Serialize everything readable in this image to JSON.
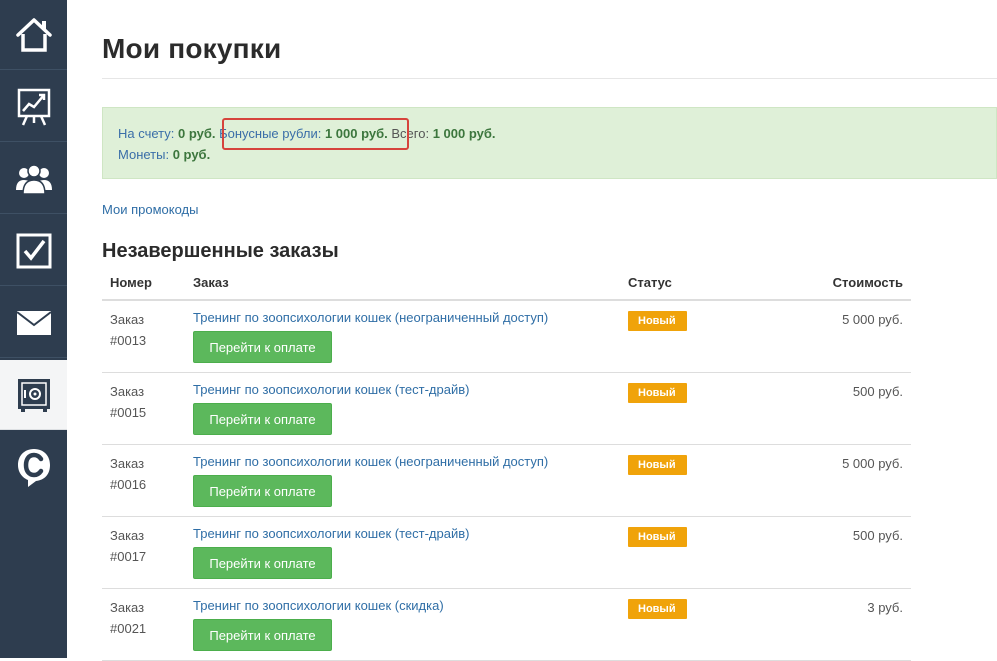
{
  "page": {
    "title": "Мои покупки"
  },
  "colors": {
    "sidebar_bg": "#2e3d4f",
    "balance_bg": "#dff0d8",
    "pay_button": "#5cb85c",
    "status_new": "#f0a30a",
    "highlight_border": "#d6443c",
    "link": "#2f6ea6"
  },
  "sidebar": {
    "items": [
      {
        "name": "home",
        "icon": "home-icon"
      },
      {
        "name": "stats",
        "icon": "chart-board-icon"
      },
      {
        "name": "users",
        "icon": "users-icon"
      },
      {
        "name": "tasks",
        "icon": "checkbox-icon"
      },
      {
        "name": "messages",
        "icon": "envelope-icon"
      },
      {
        "name": "purchases",
        "icon": "safe-icon",
        "active": true
      },
      {
        "name": "chat",
        "icon": "chat-c-icon"
      }
    ]
  },
  "balance": {
    "account_label": "На счету:",
    "account_value": "0 руб.",
    "bonus_label": "Бонусные рубли:",
    "bonus_value": "1 000 руб.",
    "total_label": "Всего:",
    "total_value": "1 000 руб.",
    "coins_label": "Монеты:",
    "coins_value": "0 руб."
  },
  "promo_link": "Мои промокоды",
  "orders_section": {
    "title": "Незавершенные заказы",
    "headers": {
      "number": "Номер",
      "order": "Заказ",
      "status": "Статус",
      "cost": "Стоимость"
    },
    "pay_label": "Перейти к оплате",
    "rows": [
      {
        "num_label": "Заказ",
        "num": "#0013",
        "title": "Тренинг по зоопсихологии кошек (неограниченный доступ)",
        "status": "Новый",
        "cost": "5 000 руб."
      },
      {
        "num_label": "Заказ",
        "num": "#0015",
        "title": "Тренинг по зоопсихологии кошек (тест-драйв)",
        "status": "Новый",
        "cost": "500 руб."
      },
      {
        "num_label": "Заказ",
        "num": "#0016",
        "title": "Тренинг по зоопсихологии кошек (неограниченный доступ)",
        "status": "Новый",
        "cost": "5 000 руб."
      },
      {
        "num_label": "Заказ",
        "num": "#0017",
        "title": "Тренинг по зоопсихологии кошек (тест-драйв)",
        "status": "Новый",
        "cost": "500 руб."
      },
      {
        "num_label": "Заказ",
        "num": "#0021",
        "title": "Тренинг по зоопсихологии кошек (скидка)",
        "status": "Новый",
        "cost": "3 руб."
      }
    ]
  }
}
